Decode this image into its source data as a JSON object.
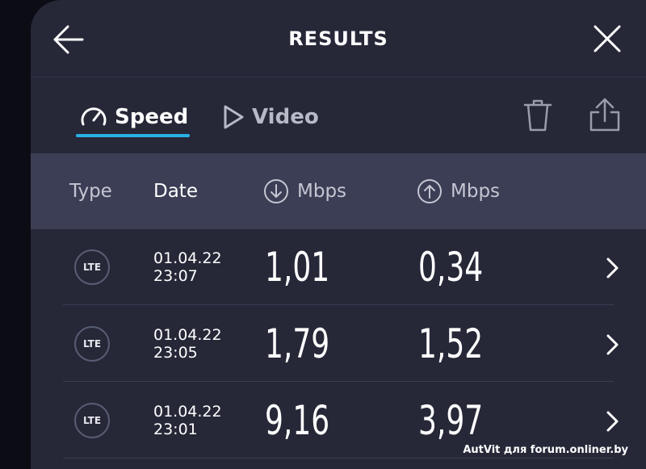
{
  "header": {
    "title": "RESULTS",
    "back_icon": "arrow-left-icon",
    "close_icon": "close-icon"
  },
  "tabs": [
    {
      "label": "Speed",
      "icon": "speedometer-icon",
      "active": true
    },
    {
      "label": "Video",
      "icon": "play-icon",
      "active": false
    }
  ],
  "toolbar": {
    "delete_icon": "trash-icon",
    "share_icon": "share-icon"
  },
  "accent_color": "#29b1e6",
  "columns": {
    "type": "Type",
    "date": "Date",
    "download": "Mbps",
    "upload": "Mbps"
  },
  "rows": [
    {
      "type": "LTE",
      "date": "01.04.22",
      "time": "23:07",
      "download": "1,01",
      "upload": "0,34"
    },
    {
      "type": "LTE",
      "date": "01.04.22",
      "time": "23:05",
      "download": "1,79",
      "upload": "1,52"
    },
    {
      "type": "LTE",
      "date": "01.04.22",
      "time": "23:01",
      "download": "9,16",
      "upload": "3,97"
    }
  ],
  "watermark": "AutVit для forum.onliner.by"
}
